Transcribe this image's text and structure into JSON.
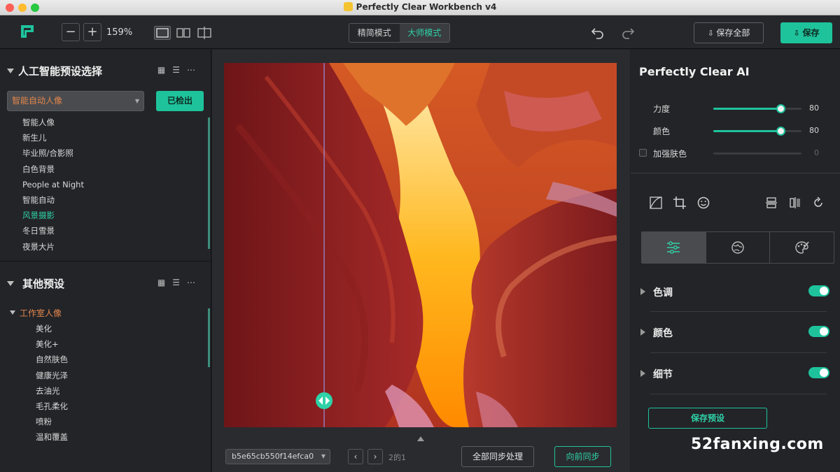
{
  "window": {
    "title": "Perfectly Clear Workbench v4"
  },
  "toolbar": {
    "zoom_out": "−",
    "zoom_in": "+",
    "zoom_value": "159%",
    "mode_simple": "精简模式",
    "mode_master": "大师模式",
    "save_all": "保存全部",
    "save": "保存",
    "accent": "#1ec39c"
  },
  "left": {
    "ai_section": {
      "title": "人工智能预设选择",
      "selected": "智能自动人像",
      "detect_button": "已检出",
      "items": [
        "智能人像",
        "新生儿",
        "毕业照/合影照",
        "白色背景",
        "People at Night",
        "智能自动",
        "风景摄影",
        "冬日雪景",
        "夜景大片"
      ],
      "active_item": "风景摄影"
    },
    "other_section": {
      "title": "其他预设",
      "group": "工作室人像",
      "items": [
        "美化",
        "美化+",
        "自然肤色",
        "健康光泽",
        "去油光",
        "毛孔柔化",
        "喷粉",
        "温和覆盖"
      ]
    }
  },
  "center": {
    "file_name": "b5e65cb550f14efca0",
    "prev": "‹",
    "next": "›",
    "page_count": "2的1",
    "sync_all": "全部同步处理",
    "sync_forward": "向前同步",
    "compare_split": 0.255
  },
  "right": {
    "title": "Perfectly Clear AI",
    "sliders": [
      {
        "label": "力度",
        "value": "80",
        "fraction": 0.76
      },
      {
        "label": "颜色",
        "value": "80",
        "fraction": 0.76
      },
      {
        "label": "加强肤色",
        "value": "0",
        "fraction": 0.0
      }
    ],
    "sections": [
      {
        "label": "色调",
        "enabled": true
      },
      {
        "label": "颜色",
        "enabled": true
      },
      {
        "label": "细节",
        "enabled": true
      }
    ],
    "save_preset": "保存预设"
  },
  "watermark": "52fanxing.com"
}
